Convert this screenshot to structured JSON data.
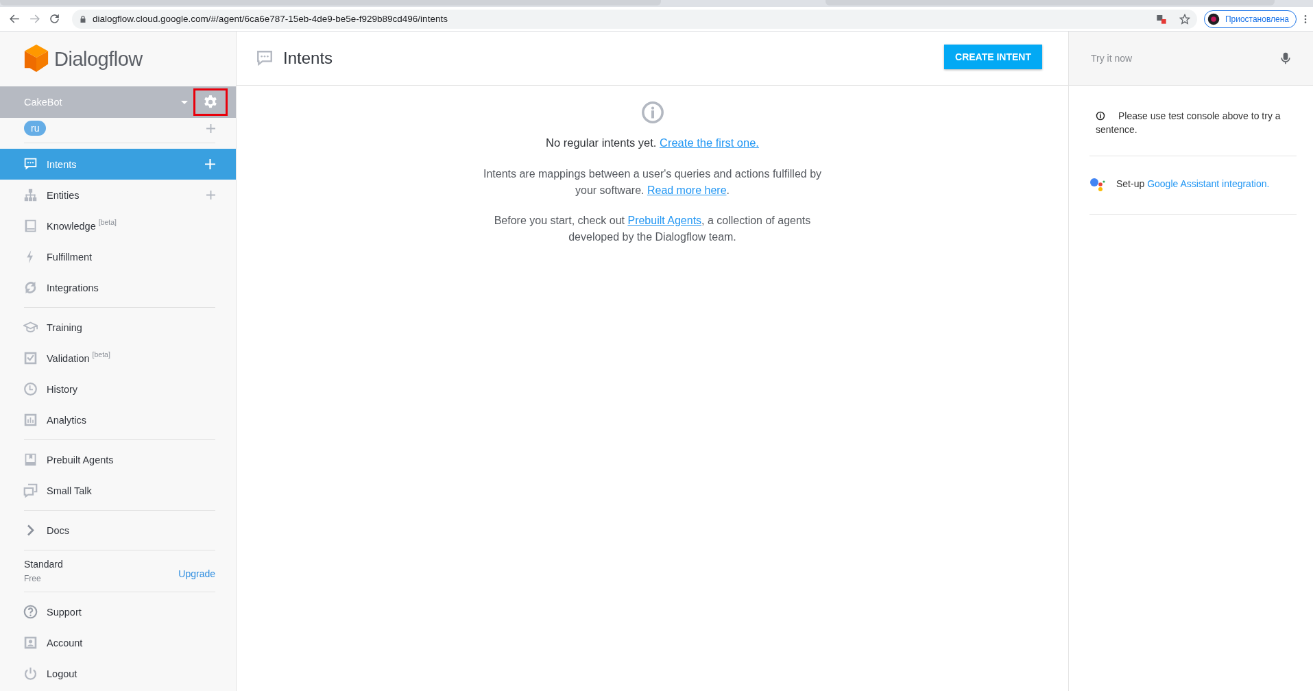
{
  "browser": {
    "url": "dialogflow.cloud.google.com/#/agent/6ca6e787-15eb-4de9-be5e-f929b89cd496/intents",
    "profile_label": "Приостановлена"
  },
  "sidebar": {
    "logo_text": "Dialogflow",
    "agent_name": "CakeBot",
    "settings_highlighted": true,
    "language": "ru",
    "nav_groups": [
      [
        {
          "label": "Intents",
          "selected": true,
          "add": true
        },
        {
          "label": "Entities",
          "selected": false,
          "add": true
        },
        {
          "label": "Knowledge",
          "badge": "[beta]",
          "selected": false,
          "add": false
        },
        {
          "label": "Fulfillment",
          "selected": false,
          "add": false
        },
        {
          "label": "Integrations",
          "selected": false,
          "add": false
        }
      ],
      [
        {
          "label": "Training",
          "selected": false,
          "add": false
        },
        {
          "label": "Validation",
          "badge": "[beta]",
          "selected": false,
          "add": false
        },
        {
          "label": "History",
          "selected": false,
          "add": false
        },
        {
          "label": "Analytics",
          "selected": false,
          "add": false
        }
      ],
      [
        {
          "label": "Prebuilt Agents",
          "selected": false,
          "add": false
        },
        {
          "label": "Small Talk",
          "selected": false,
          "add": false
        }
      ],
      [
        {
          "label": "Docs",
          "selected": false,
          "add": false
        }
      ]
    ],
    "plan": {
      "name": "Standard",
      "tier": "Free",
      "action": "Upgrade"
    },
    "footer_items": [
      {
        "label": "Support"
      },
      {
        "label": "Account"
      },
      {
        "label": "Logout"
      }
    ]
  },
  "main": {
    "title": "Intents",
    "create_button": "CREATE INTENT",
    "empty_heading": {
      "text": "No regular intents yet.",
      "link": "Create the first one."
    },
    "paragraphs": [
      {
        "before": "Intents are mappings between a user's queries and actions fulfilled by your software.",
        "link": "Read more here",
        "after": "."
      },
      {
        "before": "Before you start, check out",
        "link": "Prebuilt Agents",
        "after": ", a collection of agents developed by the Dialogflow team."
      }
    ]
  },
  "console": {
    "placeholder": "Try it now",
    "info": "Please use test console above to try a sentence.",
    "assistant_prefix": "Set-up",
    "assistant_link": "Google Assistant integration."
  }
}
